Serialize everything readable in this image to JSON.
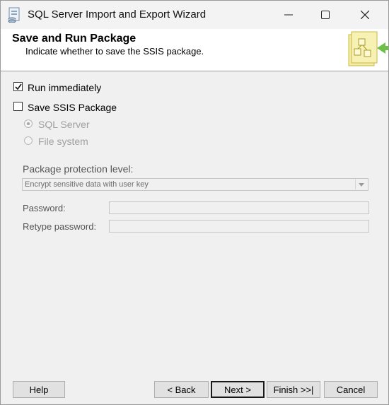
{
  "window": {
    "title": "SQL Server Import and Export Wizard"
  },
  "header": {
    "title": "Save and Run Package",
    "subtitle": "Indicate whether to save the SSIS package."
  },
  "options": {
    "run_immediately": {
      "label": "Run immediately",
      "checked": true
    },
    "save_ssis": {
      "label": "Save SSIS Package",
      "checked": false
    },
    "locations": [
      {
        "label": "SQL Server",
        "selected": true,
        "enabled": false
      },
      {
        "label": "File system",
        "selected": false,
        "enabled": false
      }
    ]
  },
  "protection": {
    "label": "Package protection level:",
    "selected": "Encrypt sensitive data with user key"
  },
  "password": {
    "label": "Password:",
    "value": ""
  },
  "retype_password": {
    "label": "Retype password:",
    "value": ""
  },
  "buttons": {
    "help": "Help",
    "back": "< Back",
    "next": "Next >",
    "finish": "Finish >>|",
    "cancel": "Cancel"
  }
}
